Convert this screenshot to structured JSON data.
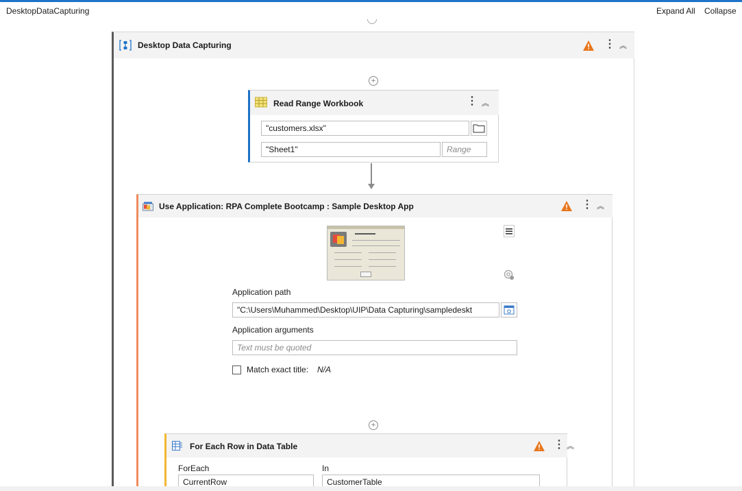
{
  "header": {
    "breadcrumb": "DesktopDataCapturing",
    "expand_all": "Expand All",
    "collapse_all": "Collapse"
  },
  "sequence": {
    "title": "Desktop Data Capturing",
    "icon": "sequence-icon"
  },
  "read_range": {
    "title": "Read Range Workbook",
    "icon": "excel-range-icon",
    "workbook_path": "\"customers.xlsx\"",
    "sheet_name": "\"Sheet1\"",
    "range_placeholder": "Range"
  },
  "use_app": {
    "title": "Use Application: RPA Complete Bootcamp : Sample Desktop App",
    "icon": "application-icon",
    "path_label": "Application path",
    "path_value": "\"C:\\Users\\Muhammed\\Desktop\\UIP\\Data Capturing\\sampledeskt",
    "args_label": "Application arguments",
    "args_placeholder": "Text must be quoted",
    "match_label": "Match exact title:",
    "match_value": "N/A"
  },
  "for_each": {
    "title": "For Each Row in Data Table",
    "icon": "datatable-icon",
    "foreach_label": "ForEach",
    "in_label": "In",
    "foreach_value": "CurrentRow",
    "in_value": "CustomerTable"
  },
  "colors": {
    "accent_blue": "#1e73c8",
    "accent_orange": "#f08a5d",
    "accent_yellow": "#f2b632",
    "warning": "#e8761c"
  }
}
